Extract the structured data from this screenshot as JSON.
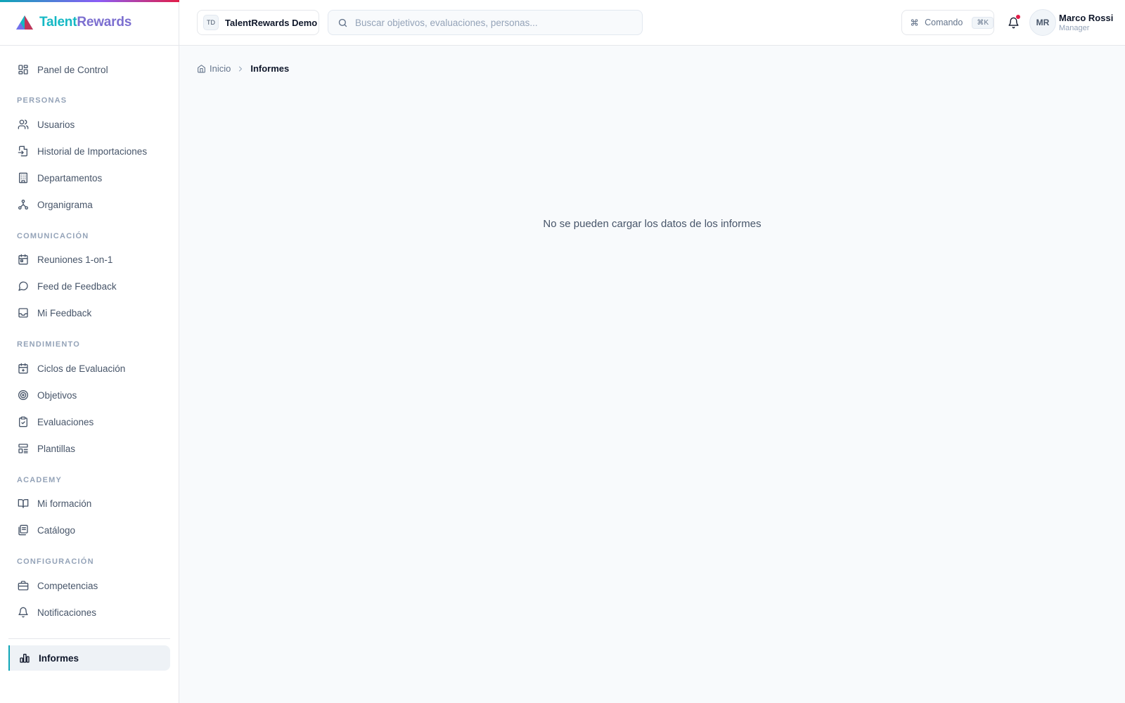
{
  "brand": {
    "part1": "Talent",
    "part2": "Rewards"
  },
  "sidebar": {
    "dashboard": "Panel de Control",
    "sections": {
      "personas": "PERSONAS",
      "comunicacion": "COMUNICACIÓN",
      "rendimiento": "RENDIMIENTO",
      "academy": "ACADEMY",
      "configuracion": "CONFIGURACIÓN"
    },
    "items": {
      "usuarios": "Usuarios",
      "historial": "Historial de Importaciones",
      "departamentos": "Departamentos",
      "organigrama": "Organigrama",
      "reuniones": "Reuniones 1-on-1",
      "feed": "Feed de Feedback",
      "mi_feedback": "Mi Feedback",
      "ciclos": "Ciclos de Evaluación",
      "objetivos": "Objetivos",
      "evaluaciones": "Evaluaciones",
      "plantillas": "Plantillas",
      "mi_formacion": "Mi formación",
      "catalogo": "Catálogo",
      "competencias": "Competencias",
      "notificaciones": "Notificaciones",
      "informes": "Informes"
    },
    "active": "informes"
  },
  "header": {
    "org_badge": "TD",
    "org_name": "TalentRewards Demo",
    "search_placeholder": "Buscar objetivos, evaluaciones, personas...",
    "command_label": "Comando",
    "command_kbd": "⌘K",
    "avatar_initials": "MR",
    "user_name": "Marco Rossi",
    "user_role": "Manager"
  },
  "breadcrumb": {
    "home": "Inicio",
    "current": "Informes"
  },
  "main": {
    "empty_message": "No se pueden cargar los datos de los informes"
  },
  "colors": {
    "accent": "#0ea5b7",
    "brand_teal": "#14b8c4",
    "brand_purple": "#7c6fd0",
    "notification": "#e11d48"
  }
}
